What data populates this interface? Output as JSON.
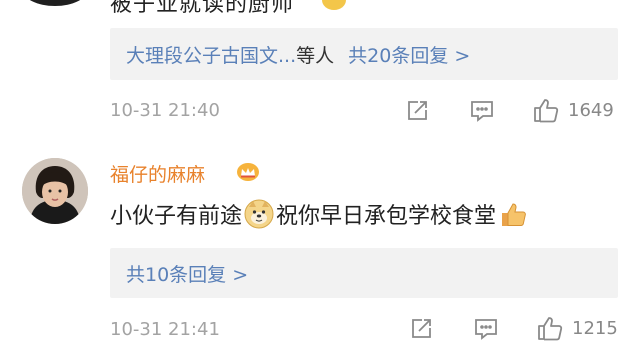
{
  "comments": [
    {
      "text": "被子业就读的厨师",
      "replies": {
        "names": "大理段公子古国文...",
        "suffix": "等人",
        "count_label": "共20条回复 >"
      },
      "time": "10-31 21:40",
      "likes": "1649",
      "avatar_icon": "avatar-icon",
      "emoji_icon": "smiley-emoji-icon"
    },
    {
      "username": "福仔的麻麻",
      "badge_icon": "vip-crown-icon",
      "text_before": "小伙子有前途",
      "emoji_icon": "doge-emoji-icon",
      "text_after": "祝你早日承包学校食堂",
      "end_icon": "thumbs-up-emoji-icon",
      "replies": {
        "count_label": "共10条回复 >"
      },
      "time": "10-31 21:41",
      "likes": "1215",
      "avatar_icon": "avatar-icon"
    }
  ],
  "colors": {
    "username": "#e8822c",
    "link": "#5a80b8",
    "meta": "#a3a3a3",
    "reply_bg": "#f2f2f2"
  },
  "icons": {
    "share": "share-icon",
    "comment": "comment-icon",
    "like": "like-icon"
  }
}
